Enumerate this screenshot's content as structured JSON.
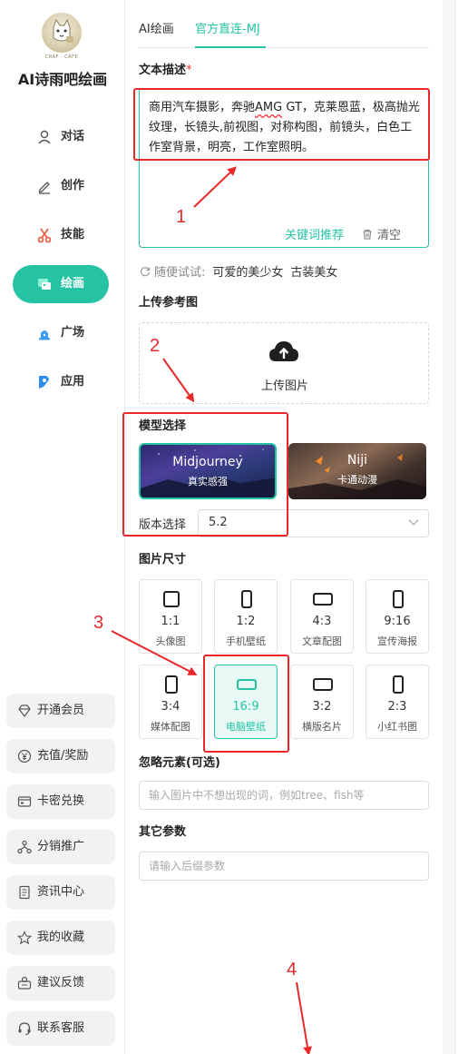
{
  "sidebar": {
    "logo_caption": "CRAF · CAFE",
    "app_title": "AI诗雨吧绘画",
    "nav": [
      {
        "label": "对话",
        "icon": "user-icon"
      },
      {
        "label": "创作",
        "icon": "pen-icon"
      },
      {
        "label": "技能",
        "icon": "scissors-icon"
      },
      {
        "label": "绘画",
        "icon": "paint-icon",
        "active": true
      },
      {
        "label": "广场",
        "icon": "siren-icon"
      },
      {
        "label": "应用",
        "icon": "app-icon"
      }
    ],
    "bottom_buttons": [
      {
        "label": "开通会员",
        "icon": "diamond-icon"
      },
      {
        "label": "充值/奖励",
        "icon": "yen-icon"
      },
      {
        "label": "卡密兑换",
        "icon": "card-icon"
      },
      {
        "label": "分销推广",
        "icon": "share-icon"
      },
      {
        "label": "资讯中心",
        "icon": "document-icon"
      },
      {
        "label": "我的收藏",
        "icon": "star-icon"
      },
      {
        "label": "建议反馈",
        "icon": "feedback-icon"
      },
      {
        "label": "联系客服",
        "icon": "headset-icon"
      }
    ]
  },
  "tabs": [
    {
      "label": "AI绘画",
      "active": false
    },
    {
      "label": "官方直连-MJ",
      "active": true
    }
  ],
  "prompt": {
    "label": "文本描述",
    "required_mark": "*",
    "value_before": "商用汽车摄影，奔驰",
    "value_underlined": "AMG",
    "value_after": " GT，克莱恩蓝，极高抛光纹理，长镜头,前视图，对称构图，前镜头，白色工作室背景，明亮，工作室照明。",
    "keyword_button": "关键词推荐",
    "clear_button": "清空"
  },
  "random_try": {
    "label": "随便试试:",
    "chips": [
      "可爱的美少女",
      "古装美女"
    ]
  },
  "upload": {
    "label": "上传参考图",
    "button": "上传图片"
  },
  "model": {
    "label": "模型选择",
    "options": [
      {
        "name": "Midjourney",
        "sub": "真实感强",
        "selected": true
      },
      {
        "name": "Niji",
        "sub": "卡通动漫",
        "selected": false
      }
    ],
    "version_label": "版本选择",
    "version_value": "5.2"
  },
  "size": {
    "label": "图片尺寸",
    "options": [
      {
        "ratio": "1:1",
        "name": "头像图"
      },
      {
        "ratio": "1:2",
        "name": "手机壁纸"
      },
      {
        "ratio": "4:3",
        "name": "文章配图"
      },
      {
        "ratio": "9:16",
        "name": "宣传海报"
      },
      {
        "ratio": "3:4",
        "name": "媒体配图"
      },
      {
        "ratio": "16:9",
        "name": "电脑壁纸",
        "selected": true
      },
      {
        "ratio": "3:2",
        "name": "横版名片"
      },
      {
        "ratio": "2:3",
        "name": "小红书图"
      }
    ]
  },
  "negative": {
    "label": "忽略元素(可选)",
    "placeholder": "输入图片中不想出现的词，例如tree、fish等"
  },
  "other": {
    "label": "其它参数",
    "placeholder": "请输入后缀参数"
  },
  "annotations": [
    "1",
    "2",
    "3",
    "4"
  ],
  "colors": {
    "accent": "#25c3a4",
    "annotation": "#e8282b"
  }
}
